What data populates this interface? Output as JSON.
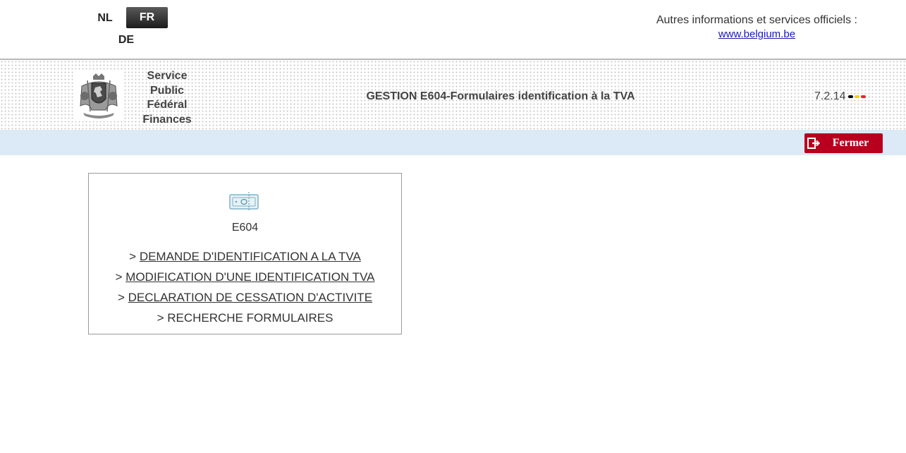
{
  "languages": {
    "nl": "NL",
    "fr": "FR",
    "de": "DE",
    "active": "FR"
  },
  "official": {
    "label": "Autres informations et services officiels :",
    "link": "www.belgium.be"
  },
  "header": {
    "org_lines": [
      "Service",
      "Public",
      "Fédéral",
      "Finances"
    ],
    "title": "GESTION E604-Formulaires identification à la TVA",
    "version": "7.2.14",
    "flag_colors": [
      "#000000",
      "#f5d000",
      "#e3262b"
    ]
  },
  "actions": {
    "close_label": "Fermer",
    "close_icon": "exit-door-icon"
  },
  "card": {
    "icon": "money-bill-icon",
    "title": "E604",
    "links": [
      {
        "prefix": "> ",
        "label": "DEMANDE D'IDENTIFICATION A LA TVA"
      },
      {
        "prefix": "> ",
        "label": "MODIFICATION D'UNE IDENTIFICATION TVA"
      },
      {
        "prefix": "> ",
        "label": "DECLARATION DE CESSATION D'ACTIVITE"
      },
      {
        "prefix": "> ",
        "label": "RECHERCHE FORMULAIRES"
      }
    ]
  },
  "colors": {
    "close_button": "#b8001e",
    "action_bar": "#dce9f6",
    "link_blue": "#1a1ab5"
  }
}
